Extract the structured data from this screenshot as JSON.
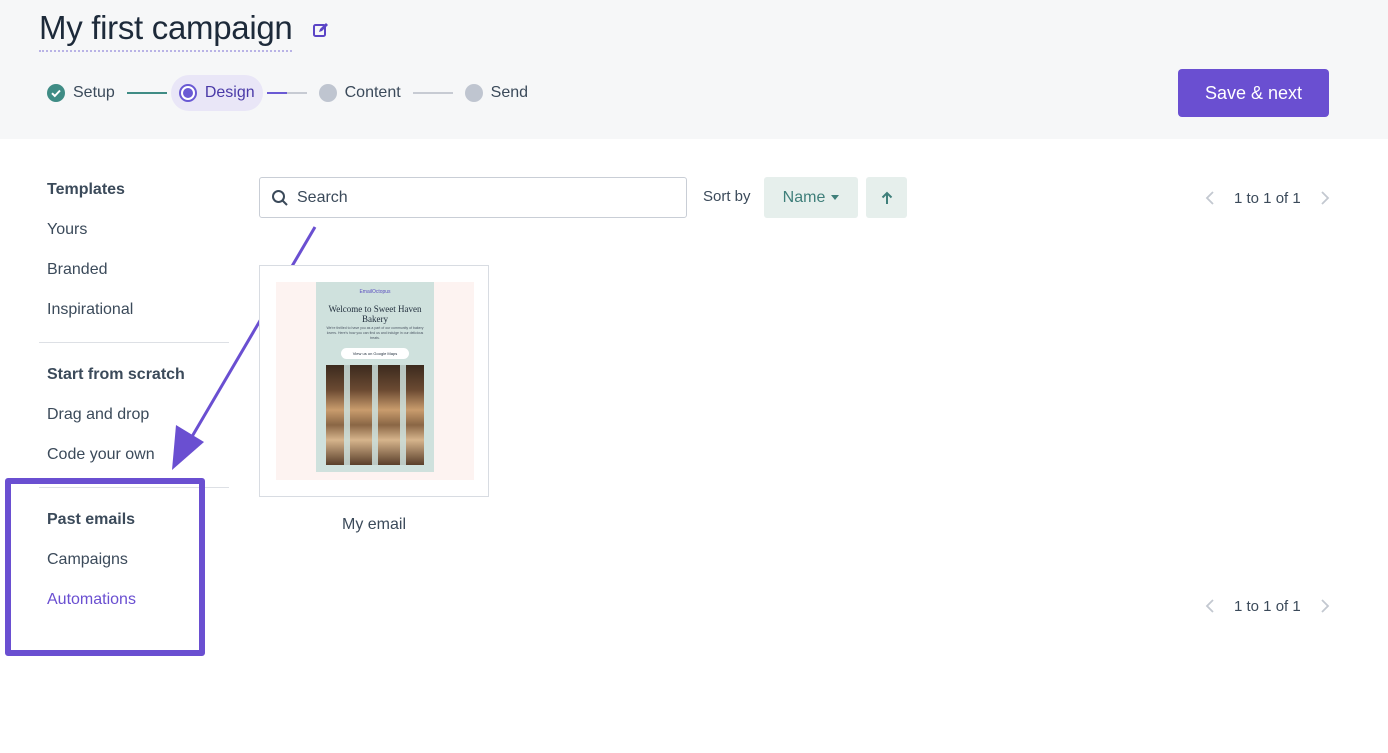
{
  "header": {
    "campaign_title": "My first campaign",
    "steps": [
      {
        "label": "Setup",
        "state": "done"
      },
      {
        "label": "Design",
        "state": "active"
      },
      {
        "label": "Content",
        "state": "todo"
      },
      {
        "label": "Send",
        "state": "todo"
      }
    ],
    "save_button_label": "Save & next"
  },
  "sidebar": {
    "groups": [
      {
        "title": "Templates",
        "items": [
          "Yours",
          "Branded",
          "Inspirational"
        ]
      },
      {
        "title": "Start from scratch",
        "items": [
          "Drag and drop",
          "Code your own"
        ]
      },
      {
        "title": "Past emails",
        "items": [
          "Campaigns",
          "Automations"
        ]
      }
    ],
    "selected_item": "Automations"
  },
  "toolbar": {
    "search_placeholder": "Search",
    "sort_label": "Sort by",
    "sort_value": "Name",
    "sort_direction": "ascending"
  },
  "pagination": {
    "top_text": "1 to 1 of 1",
    "bottom_text": "1 to 1 of 1"
  },
  "templates": [
    {
      "name": "My email",
      "preview": {
        "brand": "EmailOctopus",
        "headline": "Welcome to Sweet Haven Bakery",
        "body": "We're thrilled to have you as a part of our community of bakery lovers. Here's how you can find us and indulge in our delicious treats.",
        "cta": "View us on Google Maps"
      }
    }
  ],
  "colors": {
    "accent": "#6a4fd1",
    "step_done": "#3f8c85",
    "sort_bg": "#e6efec",
    "header_bg": "#f6f7f8"
  },
  "icons": {
    "edit": "pencil-square-icon",
    "search": "search-icon",
    "sort_direction": "arrow-up-icon",
    "prev": "chevron-left-icon",
    "next": "chevron-right-icon",
    "step_done": "check-circle-icon"
  }
}
